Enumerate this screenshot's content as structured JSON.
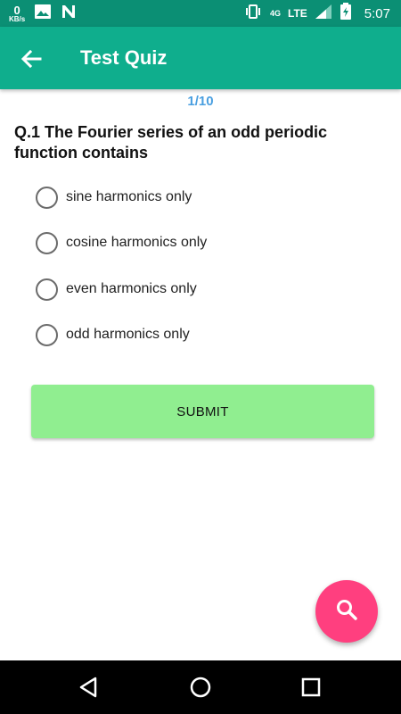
{
  "status_bar": {
    "data_rate_value": "0",
    "data_rate_unit": "KB/s",
    "network_4g": "4G",
    "network_lte": "LTE",
    "time": "5:07",
    "icons": [
      "image-icon",
      "n-notification-icon",
      "vibrate-icon",
      "signal-icon",
      "battery-icon"
    ]
  },
  "app_bar": {
    "title": "Test Quiz",
    "back_icon": "arrow-left-icon",
    "background": "#0fae8d"
  },
  "quiz": {
    "progress": "1/10",
    "question": "Q.1 The Fourier series of an odd periodic function contains",
    "options": [
      {
        "label": "sine harmonics only",
        "selected": false
      },
      {
        "label": "cosine harmonics only",
        "selected": false
      },
      {
        "label": "even harmonics only",
        "selected": false
      },
      {
        "label": "odd harmonics only",
        "selected": false
      }
    ],
    "submit_label": "SUBMIT",
    "submit_color": "#90ee90"
  },
  "fab": {
    "icon": "search-icon",
    "color": "#ff3f7f"
  },
  "nav_bar": {
    "icons": [
      "back-triangle-icon",
      "home-circle-icon",
      "recents-square-icon"
    ]
  }
}
